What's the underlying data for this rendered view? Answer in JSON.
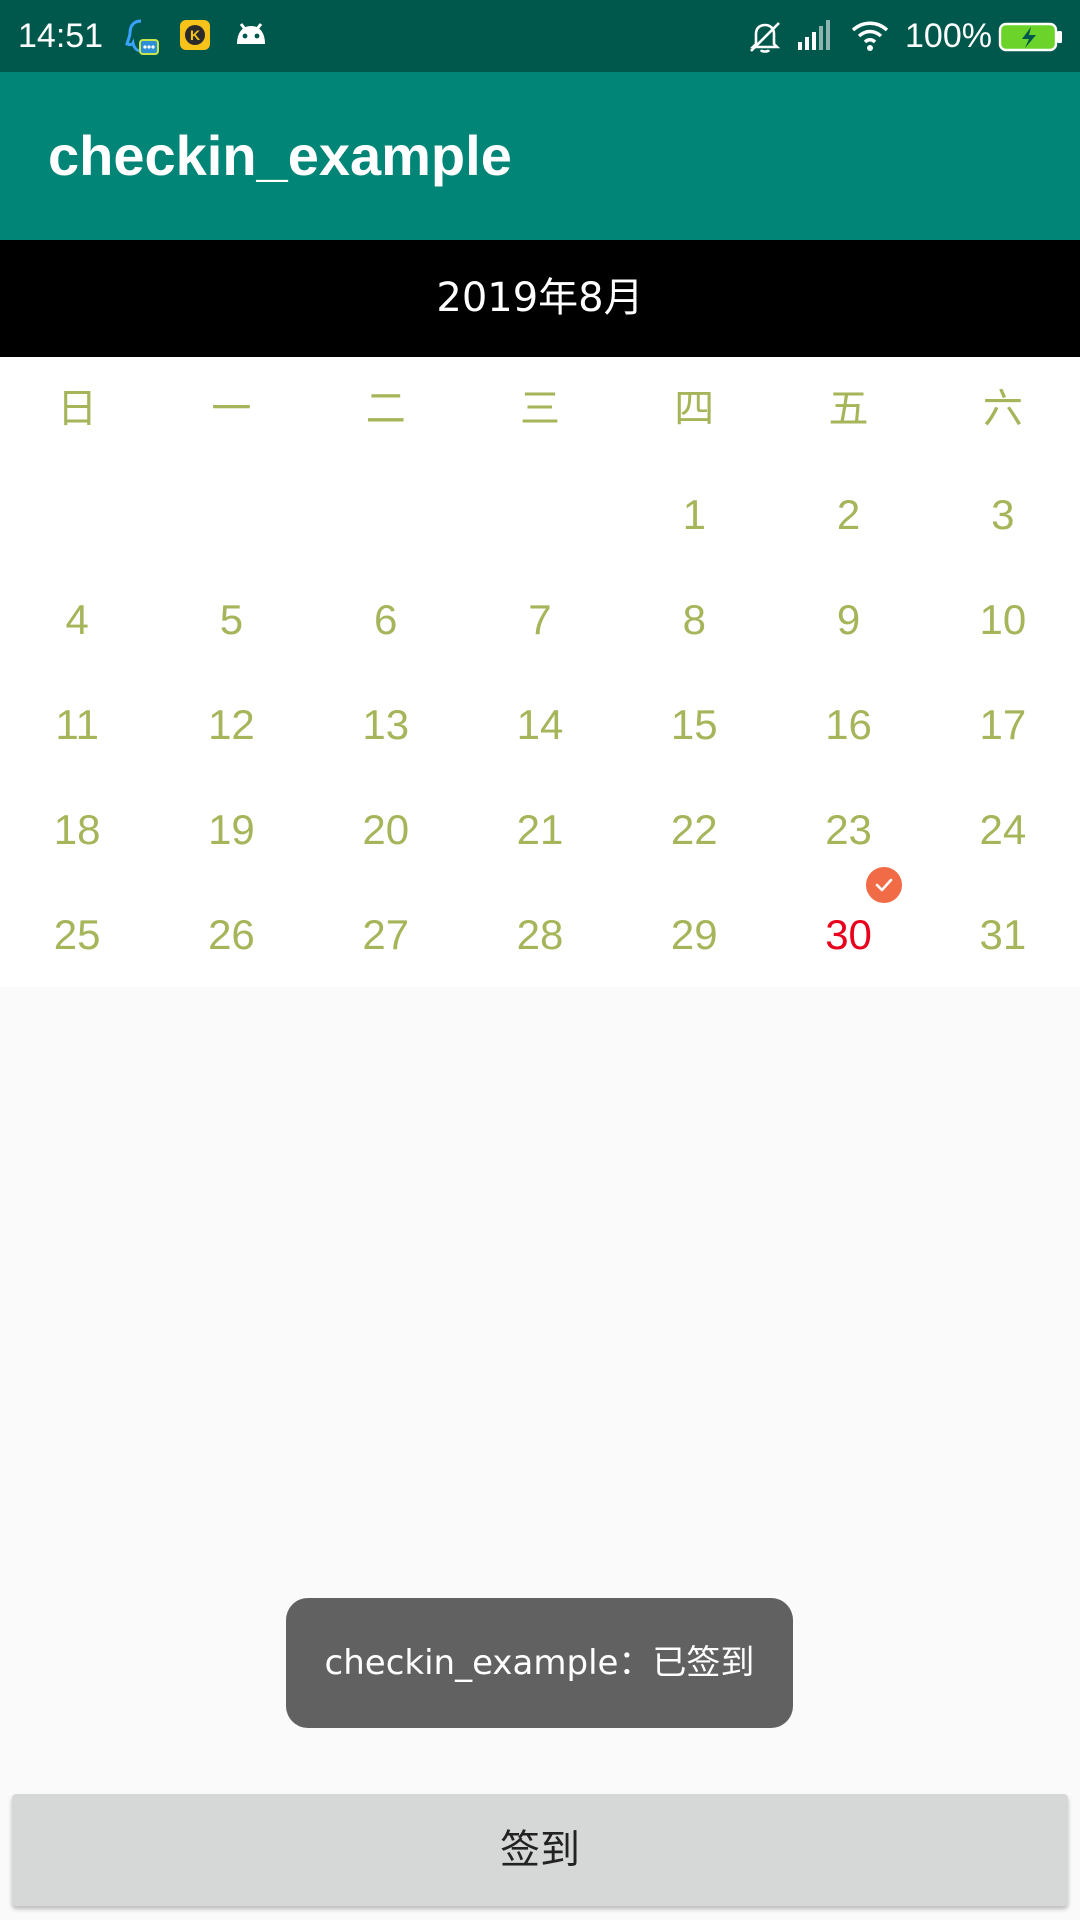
{
  "status_bar": {
    "time": "14:51",
    "battery_percent": "100%",
    "icons_left": [
      "qq-icon",
      "kk-icon",
      "android-icon"
    ],
    "icons_right": [
      "mute-icon",
      "signal-icon",
      "wifi-icon",
      "battery-icon"
    ]
  },
  "app_bar": {
    "title": "checkin_example"
  },
  "calendar": {
    "month_label": "2019年8月",
    "weekdays": [
      "日",
      "一",
      "二",
      "三",
      "四",
      "五",
      "六"
    ],
    "weeks": [
      [
        "",
        "",
        "",
        "",
        "1",
        "2",
        "3"
      ],
      [
        "4",
        "5",
        "6",
        "7",
        "8",
        "9",
        "10"
      ],
      [
        "11",
        "12",
        "13",
        "14",
        "15",
        "16",
        "17"
      ],
      [
        "18",
        "19",
        "20",
        "21",
        "22",
        "23",
        "24"
      ],
      [
        "25",
        "26",
        "27",
        "28",
        "29",
        "30",
        "31"
      ]
    ],
    "checked_day": "30",
    "colors": {
      "day_text": "#a5b55a",
      "today_text": "#e8001c",
      "badge": "#f26b47"
    }
  },
  "toast": {
    "message": "checkin_example：已签到"
  },
  "checkin_button": {
    "label": "签到"
  },
  "colors": {
    "status_bar": "#00574b",
    "app_bar": "#008577",
    "month_header": "#000000"
  }
}
